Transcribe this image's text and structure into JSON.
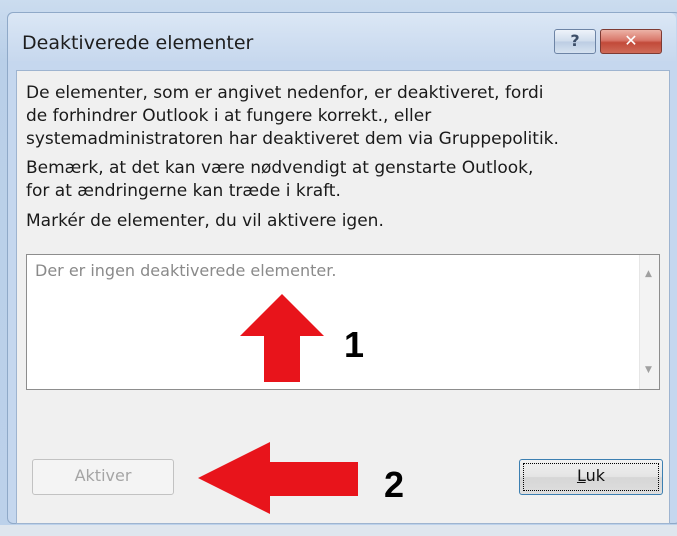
{
  "dialog": {
    "title": "Deaktiverede elementer",
    "help_label": "?",
    "close_label": "✕"
  },
  "body": {
    "para1_line1": "De elementer, som er angivet nedenfor, er deaktiveret, fordi",
    "para1_line2": "de forhindrer Outlook i at fungere korrekt., eller",
    "para1_line3": "systemadministratoren har deaktiveret dem via Gruppepolitik.",
    "para2_line1": "Bemærk, at det kan være nødvendigt at genstarte Outlook,",
    "para2_line2": "for at ændringerne kan træde i kraft.",
    "para3": "Markér de elementer, du vil aktivere igen."
  },
  "list": {
    "empty_text": "Der er ingen deaktiverede elementer."
  },
  "buttons": {
    "activate_label": "Aktiver",
    "close_label_underlined": "L",
    "close_label_rest": "uk"
  },
  "annotations": {
    "label_1": "1",
    "label_2": "2",
    "arrow_color": "#e8141b"
  },
  "colors": {
    "title_bar": "#c7d8ee",
    "close_button": "#c24a3a"
  }
}
